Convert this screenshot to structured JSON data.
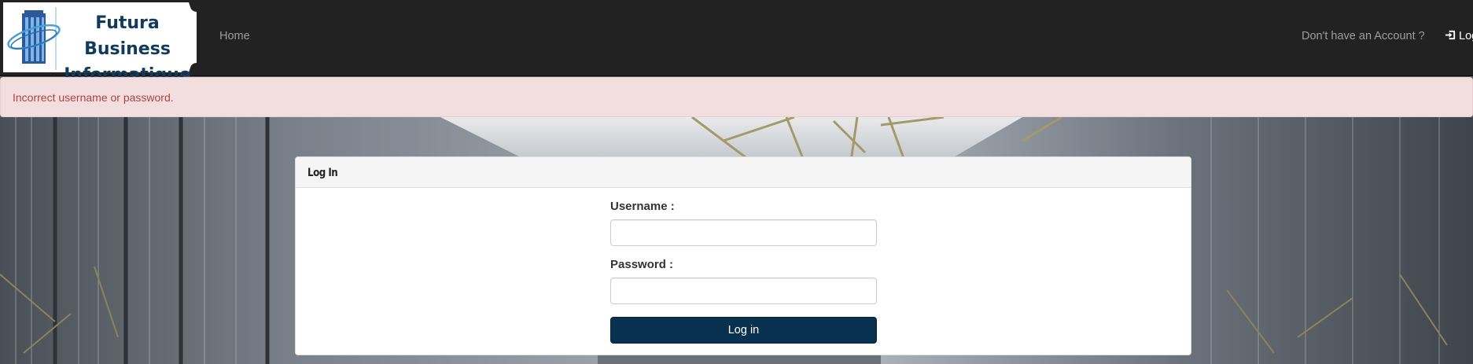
{
  "navbar": {
    "brand": {
      "line1": "Futura Business",
      "line2": "Informatique"
    },
    "links": {
      "home": "Home",
      "register": "Don't have an Account ?",
      "login": "Log in"
    },
    "login_icon": "sign-in-icon"
  },
  "alert": {
    "message": "Incorrect username or password."
  },
  "panel": {
    "title": "Log In",
    "username_label": "Username :",
    "username_value": "",
    "password_label": "Password :",
    "password_value": "",
    "submit_label": "Log in"
  },
  "colors": {
    "navbar_bg": "#222222",
    "brand_text": "#123a5c",
    "alert_bg": "#f2dede",
    "alert_text": "#a94442",
    "button_bg": "#08304f"
  }
}
